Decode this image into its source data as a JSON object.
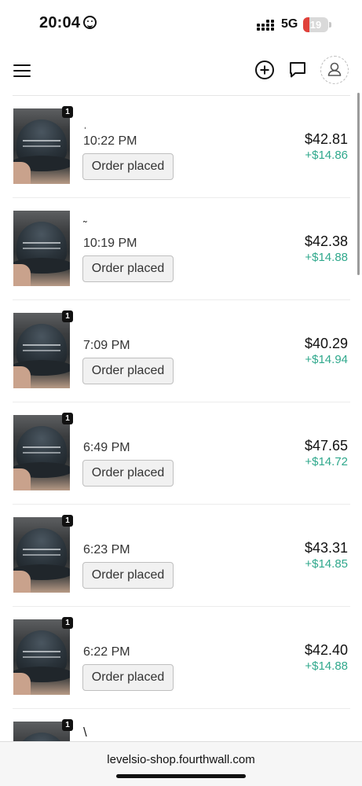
{
  "status_bar": {
    "time": "20:04",
    "network": "5G",
    "battery": "19",
    "battery_level": 0.19
  },
  "header": {
    "menu_icon": "hamburger-menu-icon",
    "add_icon": "plus-circle-icon",
    "messages_icon": "chat-bubble-icon",
    "account_icon": "user-icon"
  },
  "orders": [
    {
      "qty": "1",
      "mark": "ˌ",
      "time": "10:22 PM",
      "status": "Order placed",
      "price": "$42.81",
      "profit": "+$14.86"
    },
    {
      "qty": "",
      "mark": "˜",
      "time": "10:19 PM",
      "status": "Order placed",
      "price": "$42.38",
      "profit": "+$14.88"
    },
    {
      "qty": "1",
      "mark": "",
      "time": "7:09 PM",
      "status": "Order placed",
      "price": "$40.29",
      "profit": "+$14.94"
    },
    {
      "qty": "1",
      "mark": "",
      "time": "6:49 PM",
      "status": "Order placed",
      "price": "$47.65",
      "profit": "+$14.72"
    },
    {
      "qty": "1",
      "mark": "",
      "time": "6:23 PM",
      "status": "Order placed",
      "price": "$43.31",
      "profit": "+$14.85"
    },
    {
      "qty": "1",
      "mark": "",
      "time": "6:22 PM",
      "status": "Order placed",
      "price": "$42.40",
      "profit": "+$14.88"
    },
    {
      "qty": "1",
      "mark": "\\",
      "time": "",
      "status": "",
      "price": "",
      "profit": ""
    }
  ],
  "browser": {
    "url": "levelsio-shop.fourthwall.com"
  },
  "colors": {
    "profit": "#2fa88c",
    "battery_low": "#e0413a"
  }
}
